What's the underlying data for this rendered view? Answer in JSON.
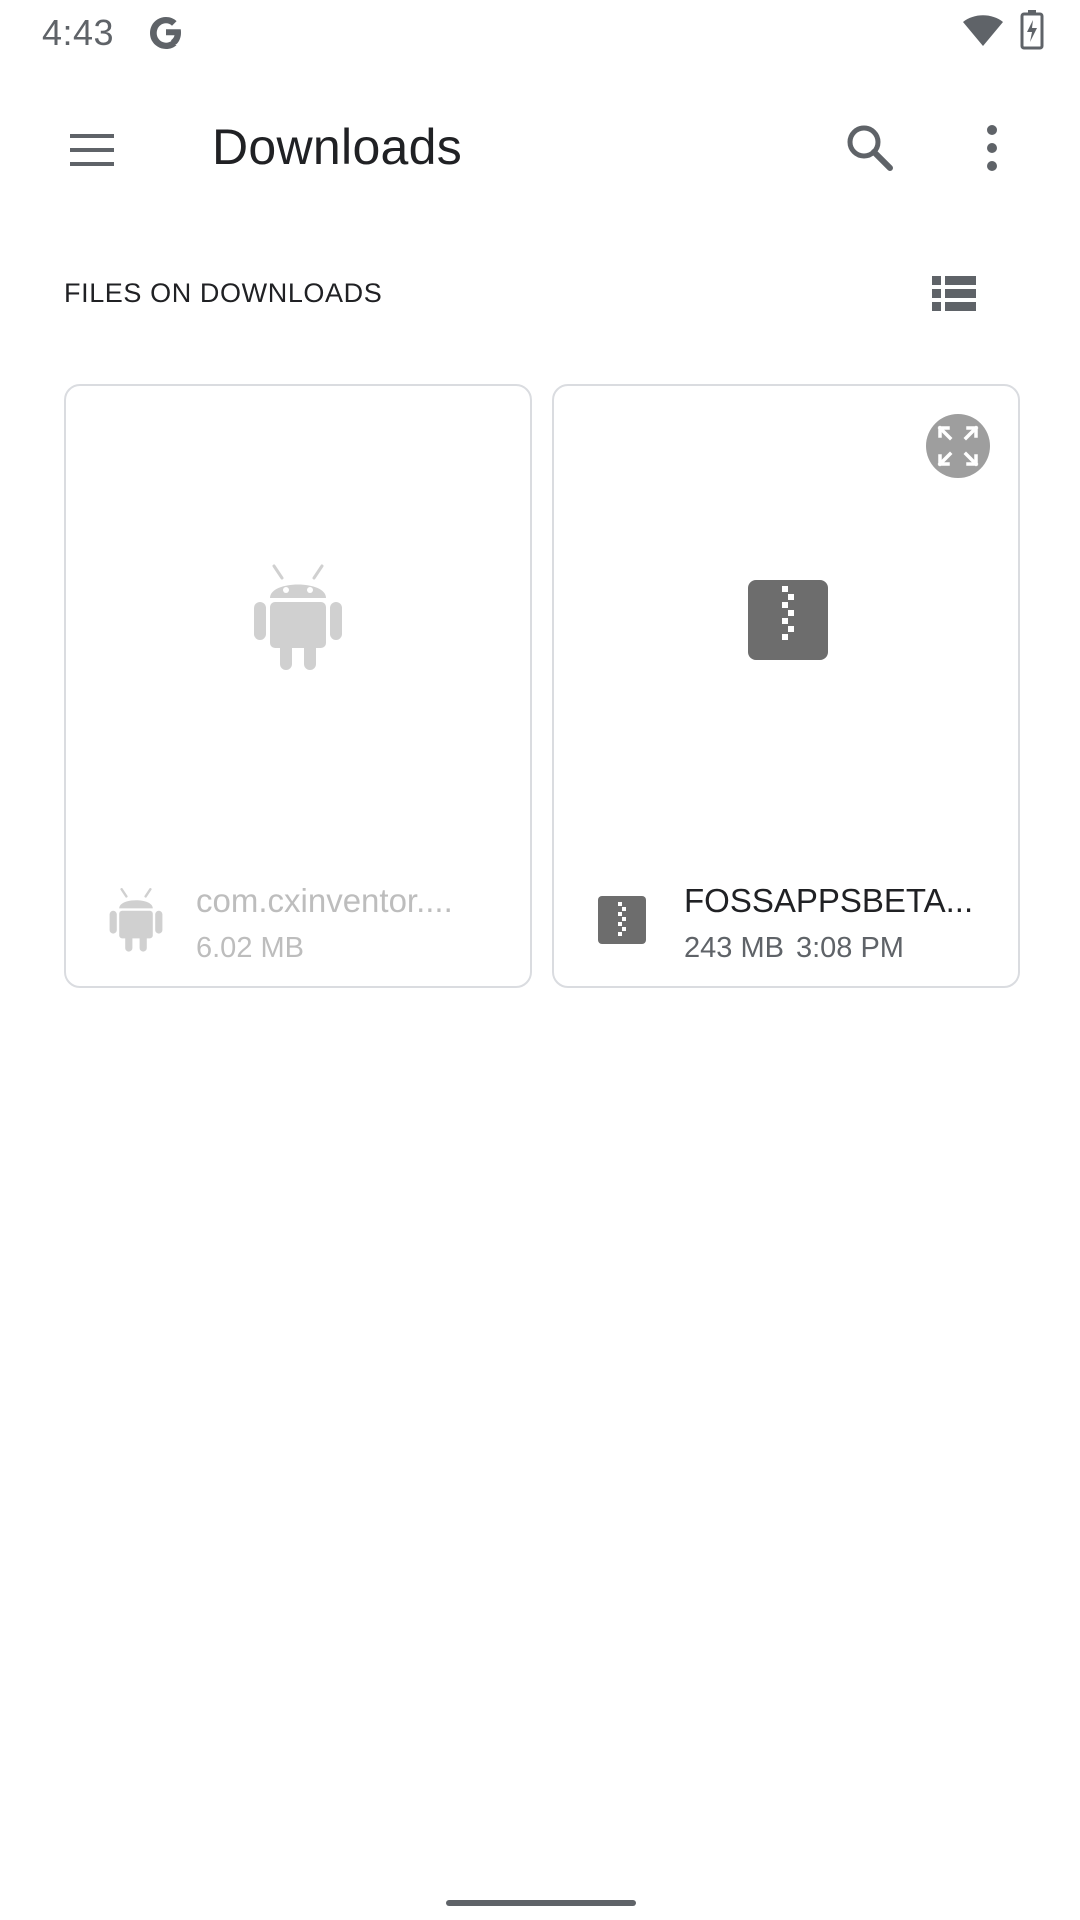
{
  "status_bar": {
    "time": "4:43",
    "icons": [
      "google-g-icon",
      "wifi-icon",
      "battery-charging-icon"
    ]
  },
  "app_bar": {
    "title": "Downloads",
    "icons": [
      "menu-icon",
      "search-icon",
      "more-vert-icon"
    ]
  },
  "section": {
    "header": "FILES ON DOWNLOADS",
    "view_toggle_icon": "view-list-icon"
  },
  "files": [
    {
      "name": "com.cxinventor....",
      "size": "6.02 MB",
      "time": "",
      "icon": "android-icon",
      "state": "disabled"
    },
    {
      "name": "FOSSAPPSBETA...",
      "size": "243 MB",
      "time": "3:08 PM",
      "icon": "archive-zip-icon",
      "action_icon": "expand-fullscreen-icon",
      "state": "enabled"
    }
  ],
  "colors": {
    "text_primary": "#202124",
    "text_secondary": "#5f6368",
    "disabled": "#bdbdbd",
    "card_border": "#dadce0"
  }
}
